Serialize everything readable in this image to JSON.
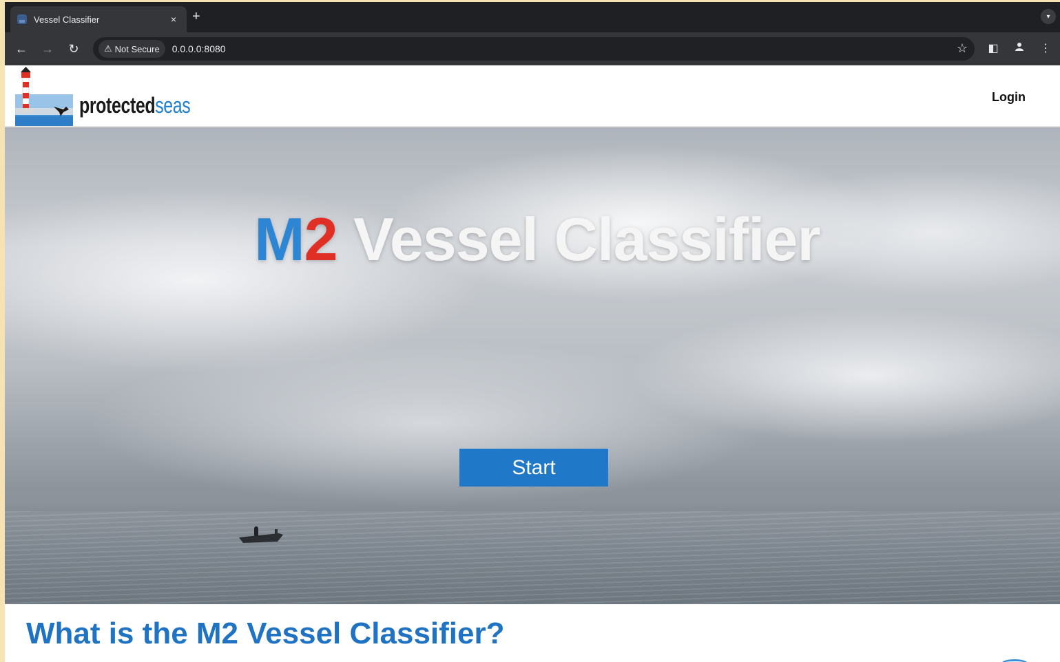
{
  "browser": {
    "tab_title": "Vessel Classifier",
    "tab_close": "×",
    "new_tab": "+",
    "security_label": "Not Secure",
    "url": "0.0.0.0:8080",
    "icons": [
      "back-arrow-icon",
      "forward-arrow-icon",
      "reload-icon",
      "warning-icon",
      "star-icon",
      "side-panel-icon",
      "profile-icon",
      "kebab-menu-icon",
      "tab-search-icon"
    ]
  },
  "header": {
    "logo_text_dark": "protected",
    "logo_text_blue": "seas",
    "login_label": "Login"
  },
  "hero": {
    "title_m": "M",
    "title_2": "2",
    "title_rest": " Vessel Classifier",
    "start_label": "Start"
  },
  "section": {
    "title": "What is the M2 Vessel Classifier?"
  },
  "colors": {
    "brand_blue": "#1f78c8",
    "accent_red": "#e03025",
    "heading_blue": "#1f73c2"
  }
}
